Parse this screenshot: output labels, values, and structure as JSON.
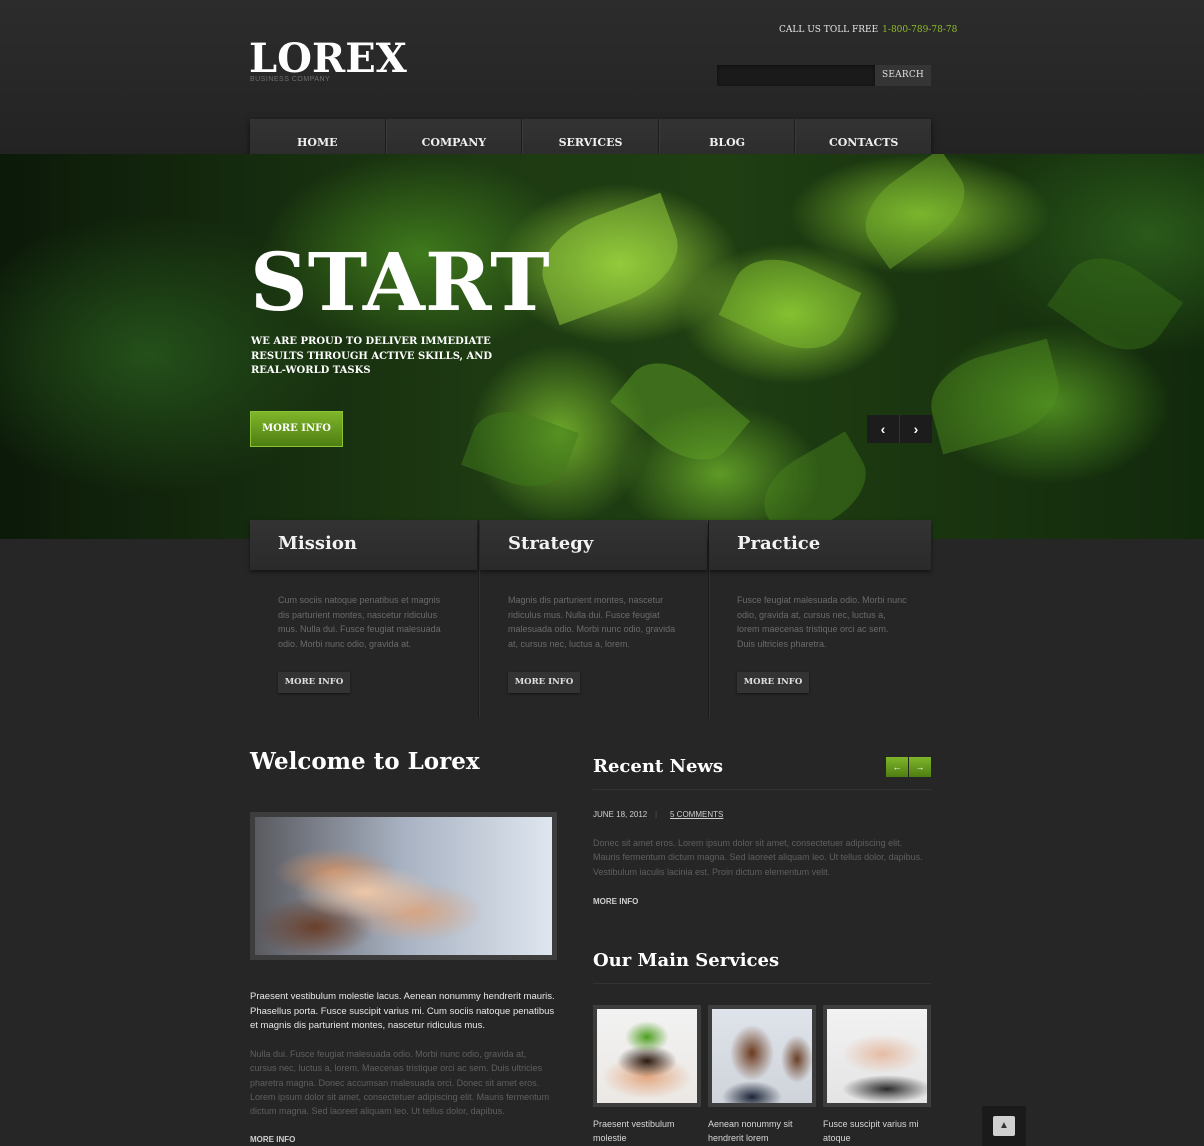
{
  "header": {
    "logo": "LOREX",
    "tagline": "BUSINESS COMPANY",
    "phone_label": "CALL US TOLL FREE",
    "phone_number": "1-800-789-78-78",
    "search_placeholder": "",
    "search_button": "SEARCH"
  },
  "nav": {
    "items": [
      {
        "label": "HOME"
      },
      {
        "label": "COMPANY"
      },
      {
        "label": "SERVICES"
      },
      {
        "label": "BLOG"
      },
      {
        "label": "CONTACTS"
      }
    ],
    "caret": "⌄"
  },
  "slider": {
    "heading": "START",
    "text": "WE ARE PROUD TO DELIVER IMMEDIATE RESULTS THROUGH ACTIVE SKILLS, AND REAL-WORLD TASKS",
    "button": "MORE INFO",
    "prev_icon": "chevron-left-icon",
    "next_icon": "chevron-right-icon"
  },
  "features": [
    {
      "title": "Mission",
      "text": "Cum sociis natoque penatibus et magnis dis parturient montes, nascetur ridiculus mus. Nulla dui. Fusce feugiat malesuada odio. Morbi nunc odio, gravida at.",
      "button": "MORE INFO"
    },
    {
      "title": "Strategy",
      "text": "Magnis dis parturient montes, nascetur ridiculus mus. Nulla dui. Fusce feugiat malesuada odio. Morbi nunc odio, gravida at, cursus nec, luctus a, lorem.",
      "button": "MORE INFO"
    },
    {
      "title": "Practice",
      "text": "Fusce feugiat malesuada odio. Morbi nunc odio, gravida at, cursus nec, luctus a, lorem maecenas tristique orci ac sem. Duis ultricies pharetra.",
      "button": "MORE INFO"
    }
  ],
  "welcome": {
    "title": "Welcome to Lorex",
    "lead": "Praesent vestibulum molestie lacus. Aenean nonummy hendrerit mauris. Phasellus porta. Fusce suscipit varius mi. Cum sociis natoque penatibus et magnis dis parturient montes, nascetur ridiculus mus.",
    "body": "Nulla dui. Fusce feugiat malesuada odio. Morbi nunc odio, gravida at, cursus nec, luctus a, lorem. Maecenas tristique orci ac sem. Duis ultricies pharetra magna. Donec accumsan malesuada orci. Donec sit amet eros. Lorem ipsum dolor sit amet, consectetuer adipiscing elit. Mauris fermentum dictum magna. Sed laoreet aliquam leo. Ut tellus dolor, dapibus.",
    "more": "MORE INFO"
  },
  "news": {
    "title": "Recent News",
    "date": "JUNE 18, 2012",
    "separator": "|",
    "comments": "5 COMMENTS",
    "body": "Donec sit amet eros. Lorem ipsum dolor sit amet, consectetuer adipiscing elit. Mauris fermentum dictum magna. Sed laoreet aliquam leo. Ut tellus dolor, dapibus. Vestibulum iaculis lacinia est. Proin dictum elementum velit.",
    "more": "MORE INFO",
    "prev_arrow": "←",
    "next_arrow": "→"
  },
  "services": {
    "title": "Our Main Services",
    "items": [
      {
        "label": "Praesent vestibulum molestie"
      },
      {
        "label": "Aenean nonummy sit hendrerit lorem"
      },
      {
        "label": "Fusce suscipit varius mi atoque"
      }
    ]
  },
  "scroll_top": "▲",
  "colors": {
    "accent_green": "#8dbb2a",
    "background": "#262626",
    "panel": "#2f2f2f"
  }
}
